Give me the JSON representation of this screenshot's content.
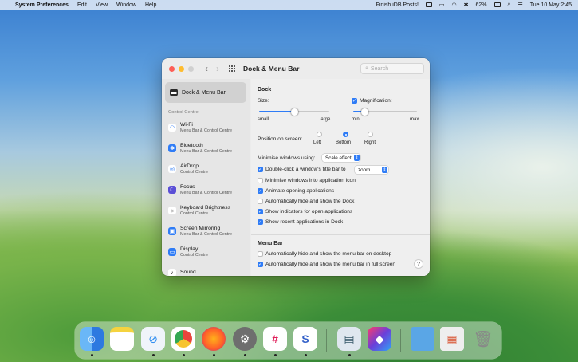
{
  "menubar": {
    "app_name": "System Preferences",
    "menus": [
      "Edit",
      "View",
      "Window",
      "Help"
    ],
    "status_text": "Finish iDB Posts!",
    "battery": "62%",
    "datetime": "Tue 10 May  2:45"
  },
  "window": {
    "title": "Dock & Menu Bar",
    "search_placeholder": "Search"
  },
  "sidebar": {
    "selected": "Dock & Menu Bar",
    "section_label": "Control Centre",
    "items": [
      {
        "title": "Wi-Fi",
        "subtitle": "Menu Bar & Control Centre",
        "icon": "wifi-icon",
        "color": "#ffffff"
      },
      {
        "title": "Bluetooth",
        "subtitle": "Menu Bar & Control Centre",
        "icon": "bluetooth-icon",
        "color": "#2f7cf6"
      },
      {
        "title": "AirDrop",
        "subtitle": "Control Centre",
        "icon": "airdrop-icon",
        "color": "#ffffff"
      },
      {
        "title": "Focus",
        "subtitle": "Menu Bar & Control Centre",
        "icon": "moon-icon",
        "color": "#5b4fd6"
      },
      {
        "title": "Keyboard Brightness",
        "subtitle": "Control Centre",
        "icon": "brightness-icon",
        "color": "#ffffff"
      },
      {
        "title": "Screen Mirroring",
        "subtitle": "Menu Bar & Control Centre",
        "icon": "screen-mirroring-icon",
        "color": "#2f7cf6"
      },
      {
        "title": "Display",
        "subtitle": "Control Centre",
        "icon": "display-icon",
        "color": "#2f7cf6"
      },
      {
        "title": "Sound",
        "subtitle": "",
        "icon": "sound-icon",
        "color": "#ffffff"
      }
    ]
  },
  "dock_section": {
    "title": "Dock",
    "size_label": "Size:",
    "size_small": "small",
    "size_large": "large",
    "size_value": 0.5,
    "magnification_label": "Magnification:",
    "magnification_checked": true,
    "mag_min": "min",
    "mag_max": "max",
    "magnification_value": 0.18,
    "position_label": "Position on screen:",
    "positions": [
      "Left",
      "Bottom",
      "Right"
    ],
    "position_selected": "Bottom",
    "minimise_label": "Minimise windows using:",
    "minimise_value": "Scale effect",
    "double_click_label": "Double-click a window's title bar to",
    "double_click_checked": true,
    "double_click_value": "zoom",
    "options": [
      {
        "label": "Minimise windows into application icon",
        "checked": false
      },
      {
        "label": "Animate opening applications",
        "checked": true
      },
      {
        "label": "Automatically hide and show the Dock",
        "checked": false
      },
      {
        "label": "Show indicators for open applications",
        "checked": true
      },
      {
        "label": "Show recent applications in Dock",
        "checked": true
      }
    ]
  },
  "menubar_section": {
    "title": "Menu Bar",
    "options": [
      {
        "label": "Automatically hide and show the menu bar on desktop",
        "checked": false
      },
      {
        "label": "Automatically hide and show the menu bar in full screen",
        "checked": true
      }
    ],
    "help": "?"
  },
  "dock": {
    "apps": [
      {
        "name": "Finder",
        "color": "#3d8ef0",
        "running": true
      },
      {
        "name": "Notes",
        "color": "#f5d33f",
        "running": false
      },
      {
        "name": "Safari",
        "color": "#2d8cf0",
        "running": true
      },
      {
        "name": "Chrome",
        "color": "#e8453c",
        "running": true
      },
      {
        "name": "Firefox",
        "color": "#ff7a1a",
        "running": true
      },
      {
        "name": "System Preferences",
        "color": "#6e6e6e",
        "running": true
      },
      {
        "name": "Slack",
        "color": "#ffffff",
        "running": true
      },
      {
        "name": "Simplenote",
        "color": "#3461c9",
        "running": true
      },
      {
        "name": "Preview",
        "color": "#6aa8e8",
        "running": true
      },
      {
        "name": "Shortcuts",
        "color": "#6b3fd9",
        "running": false
      },
      {
        "name": "Folder",
        "color": "#5aa6e6",
        "running": false
      },
      {
        "name": "Screenshot",
        "color": "#d95b3b",
        "running": false
      },
      {
        "name": "Trash",
        "color": "#c8c8c8",
        "running": false
      }
    ]
  }
}
